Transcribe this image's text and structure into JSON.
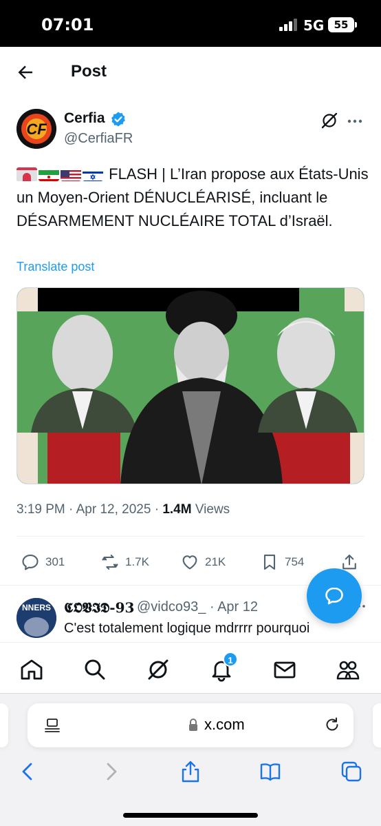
{
  "status_bar": {
    "time": "07:01",
    "network": "5G",
    "battery": "55"
  },
  "header": {
    "title": "Post"
  },
  "author": {
    "name": "Cerfia",
    "handle": "@CerfiaFR",
    "avatar_text": "CF"
  },
  "tweet": {
    "text": "FLASH | L’Iran propose aux États-Unis un Moyen-Orient DÉNUCLÉARISÉ, incluant le DÉSARMEMENT NUCLÉAIRE TOTAL d’Israël.",
    "translate_label": "Translate post"
  },
  "meta": {
    "time": "3:19 PM",
    "date": "Apr 12, 2025",
    "views_count": "1.4M",
    "views_label": "Views",
    "sep": "·"
  },
  "actions": {
    "replies": "301",
    "reposts": "1.7K",
    "likes": "21K",
    "bookmarks": "754"
  },
  "reply": {
    "name": "𝕮𝕺𝖁𝕴𝕯-𝟗𝟑",
    "handle": "@vidco93_",
    "date": "Apr 12",
    "text": "C'est totalement logique mdrrrr pourquoi",
    "avatar_text": "NNERS"
  },
  "nav": {
    "notification_count": "1"
  },
  "browser": {
    "url": "x.com"
  },
  "colors": {
    "accent": "#1d9bf0",
    "muted": "#536471",
    "text": "#0f1419",
    "media_green": "#57a45a",
    "media_red": "#b51f24"
  }
}
